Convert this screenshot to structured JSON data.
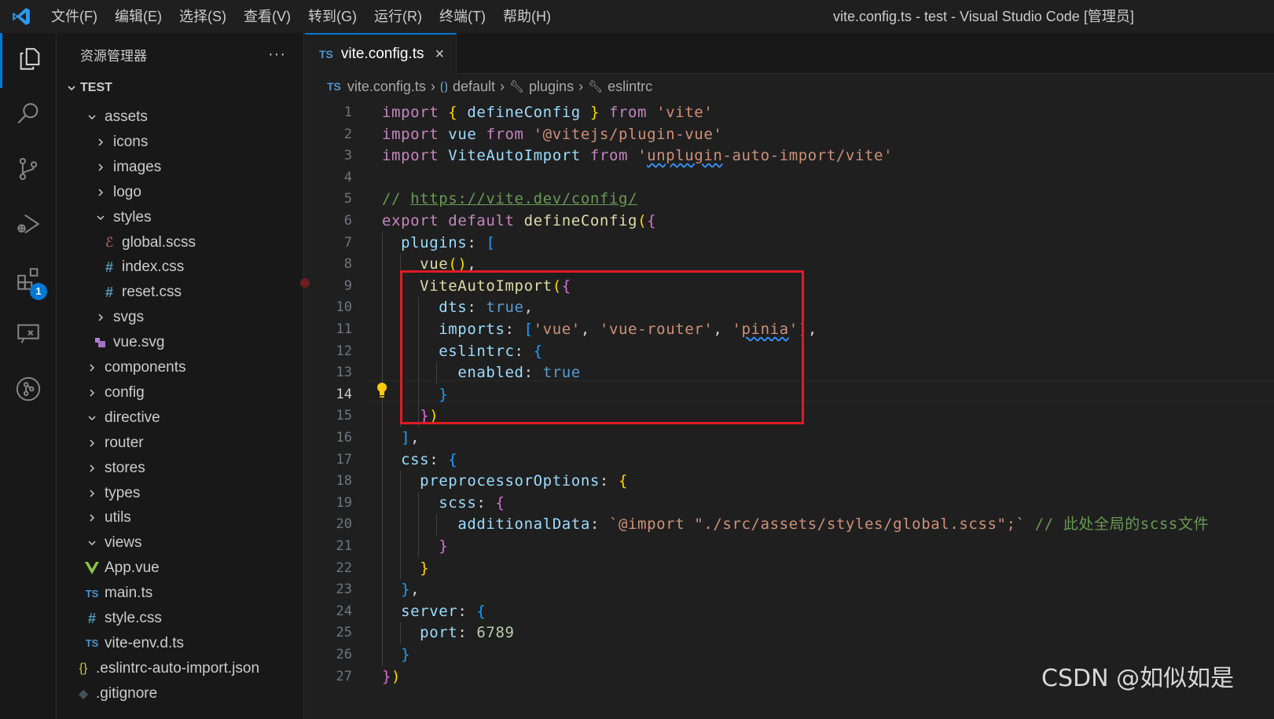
{
  "window": {
    "title": "vite.config.ts - test - Visual Studio Code [管理员]"
  },
  "menu": [
    "文件(F)",
    "编辑(E)",
    "选择(S)",
    "查看(V)",
    "转到(G)",
    "运行(R)",
    "终端(T)",
    "帮助(H)"
  ],
  "activity_bar": {
    "items": [
      {
        "icon": "files-icon",
        "active": true
      },
      {
        "icon": "search-icon"
      },
      {
        "icon": "source-control-icon"
      },
      {
        "icon": "run-debug-icon"
      },
      {
        "icon": "extensions-icon",
        "badge": "1"
      },
      {
        "icon": "remote-explorer-icon"
      },
      {
        "icon": "git-graph-icon"
      }
    ]
  },
  "sidebar": {
    "title": "资源管理器",
    "more": "···",
    "folder": "TEST",
    "tree": [
      {
        "label": "assets",
        "type": "folder-open",
        "depth": 1
      },
      {
        "label": "icons",
        "type": "folder",
        "depth": 2
      },
      {
        "label": "images",
        "type": "folder",
        "depth": 2
      },
      {
        "label": "logo",
        "type": "folder",
        "depth": 2
      },
      {
        "label": "styles",
        "type": "folder-open",
        "depth": 2
      },
      {
        "label": "global.scss",
        "type": "scss",
        "depth": 3
      },
      {
        "label": "index.css",
        "type": "css",
        "depth": 3
      },
      {
        "label": "reset.css",
        "type": "css",
        "depth": 3
      },
      {
        "label": "svgs",
        "type": "folder",
        "depth": 2
      },
      {
        "label": "vue.svg",
        "type": "svg",
        "depth": 2
      },
      {
        "label": "components",
        "type": "folder",
        "depth": 1
      },
      {
        "label": "config",
        "type": "folder",
        "depth": 1
      },
      {
        "label": "directive",
        "type": "folder-open",
        "depth": 1
      },
      {
        "label": "router",
        "type": "folder",
        "depth": 1
      },
      {
        "label": "stores",
        "type": "folder",
        "depth": 1
      },
      {
        "label": "types",
        "type": "folder",
        "depth": 1
      },
      {
        "label": "utils",
        "type": "folder",
        "depth": 1
      },
      {
        "label": "views",
        "type": "folder-open",
        "depth": 1
      },
      {
        "label": "App.vue",
        "type": "vue",
        "depth": 1
      },
      {
        "label": "main.ts",
        "type": "ts",
        "depth": 1
      },
      {
        "label": "style.css",
        "type": "css",
        "depth": 1
      },
      {
        "label": "vite-env.d.ts",
        "type": "ts",
        "depth": 1
      },
      {
        "label": ".eslintrc-auto-import.json",
        "type": "json",
        "depth": 0
      },
      {
        "label": ".gitignore",
        "type": "git",
        "depth": 0
      }
    ]
  },
  "editor": {
    "tab": {
      "badge": "TS",
      "label": "vite.config.ts",
      "close": "×"
    },
    "breadcrumb": [
      "vite.config.ts",
      "default",
      "plugins",
      "eslintrc"
    ],
    "current_line": 14,
    "lines": [
      [
        [
          "kw",
          "import "
        ],
        [
          "b1",
          "{ "
        ],
        [
          "vr",
          "defineConfig"
        ],
        [
          "b1",
          " }"
        ],
        [
          "kw",
          " from "
        ],
        [
          "st",
          "'vite'"
        ]
      ],
      [
        [
          "kw",
          "import "
        ],
        [
          "vr",
          "vue"
        ],
        [
          "kw",
          " from "
        ],
        [
          "st",
          "'@vitejs/plugin-vue'"
        ]
      ],
      [
        [
          "kw",
          "import "
        ],
        [
          "vr",
          "ViteAutoImport"
        ],
        [
          "kw",
          " from "
        ],
        [
          "st",
          "'"
        ],
        [
          "st squig",
          "unplugin"
        ],
        [
          "st",
          "-auto-import/vite'"
        ]
      ],
      [],
      [
        [
          "cm",
          "// "
        ],
        [
          "cm ul",
          "https://vite.dev/config/"
        ]
      ],
      [
        [
          "kw",
          "export "
        ],
        [
          "kw",
          "default "
        ],
        [
          "fn",
          "defineConfig"
        ],
        [
          "b1",
          "("
        ],
        [
          "b2",
          "{"
        ]
      ],
      [
        [
          "pu",
          "  "
        ],
        [
          "vr",
          "plugins"
        ],
        [
          "pu",
          ": "
        ],
        [
          "b3",
          "["
        ]
      ],
      [
        [
          "pu",
          "    "
        ],
        [
          "fn",
          "vue"
        ],
        [
          "b1",
          "()"
        ],
        [
          "pu",
          ","
        ]
      ],
      [
        [
          "pu",
          "    "
        ],
        [
          "fn",
          "ViteAutoImport"
        ],
        [
          "b1",
          "("
        ],
        [
          "b2",
          "{"
        ]
      ],
      [
        [
          "pu",
          "      "
        ],
        [
          "vr",
          "dts"
        ],
        [
          "pu",
          ": "
        ],
        [
          "kb",
          "true"
        ],
        [
          "pu",
          ","
        ]
      ],
      [
        [
          "pu",
          "      "
        ],
        [
          "vr",
          "imports"
        ],
        [
          "pu",
          ": "
        ],
        [
          "b3",
          "["
        ],
        [
          "st",
          "'vue'"
        ],
        [
          "pu",
          ", "
        ],
        [
          "st",
          "'vue-router'"
        ],
        [
          "pu",
          ", "
        ],
        [
          "st",
          "'"
        ],
        [
          "st squig",
          "pinia"
        ],
        [
          "st",
          "'"
        ],
        [
          "b3",
          "]"
        ],
        [
          "pu",
          ","
        ]
      ],
      [
        [
          "pu",
          "      "
        ],
        [
          "vr",
          "eslintrc"
        ],
        [
          "pu",
          ": "
        ],
        [
          "b3",
          "{"
        ]
      ],
      [
        [
          "pu",
          "        "
        ],
        [
          "vr",
          "enabled"
        ],
        [
          "pu",
          ": "
        ],
        [
          "kb",
          "true"
        ]
      ],
      [
        [
          "pu",
          "      "
        ],
        [
          "b3",
          "}"
        ]
      ],
      [
        [
          "pu",
          "    "
        ],
        [
          "b2",
          "}"
        ],
        [
          "b1",
          ")"
        ]
      ],
      [
        [
          "pu",
          "  "
        ],
        [
          "b3",
          "]"
        ],
        [
          "pu",
          ","
        ]
      ],
      [
        [
          "pu",
          "  "
        ],
        [
          "vr",
          "css"
        ],
        [
          "pu",
          ": "
        ],
        [
          "b3",
          "{"
        ]
      ],
      [
        [
          "pu",
          "    "
        ],
        [
          "vr",
          "preprocessorOptions"
        ],
        [
          "pu",
          ": "
        ],
        [
          "b1",
          "{"
        ]
      ],
      [
        [
          "pu",
          "      "
        ],
        [
          "vr",
          "scss"
        ],
        [
          "pu",
          ": "
        ],
        [
          "b2",
          "{"
        ]
      ],
      [
        [
          "pu",
          "        "
        ],
        [
          "vr",
          "additionalData"
        ],
        [
          "pu",
          ": "
        ],
        [
          "st",
          "`@import \"./src/assets/styles/global.scss\";`"
        ],
        [
          "cm",
          " // 此处全局的scss文件"
        ]
      ],
      [
        [
          "pu",
          "      "
        ],
        [
          "b2",
          "}"
        ]
      ],
      [
        [
          "pu",
          "    "
        ],
        [
          "b1",
          "}"
        ]
      ],
      [
        [
          "pu",
          "  "
        ],
        [
          "b3",
          "}"
        ],
        [
          "pu",
          ","
        ]
      ],
      [
        [
          "pu",
          "  "
        ],
        [
          "vr",
          "server"
        ],
        [
          "pu",
          ": "
        ],
        [
          "b3",
          "{"
        ]
      ],
      [
        [
          "pu",
          "    "
        ],
        [
          "vr",
          "port"
        ],
        [
          "pu",
          ": "
        ],
        [
          "nm",
          "6789"
        ]
      ],
      [
        [
          "pu",
          "  "
        ],
        [
          "b3",
          "}"
        ]
      ],
      [
        [
          "b2",
          "}"
        ],
        [
          "b1",
          ")"
        ]
      ]
    ]
  },
  "watermark": "CSDN @如似如是",
  "colors": {
    "accent": "#0078d4",
    "highlight_box": "#e01b24"
  }
}
